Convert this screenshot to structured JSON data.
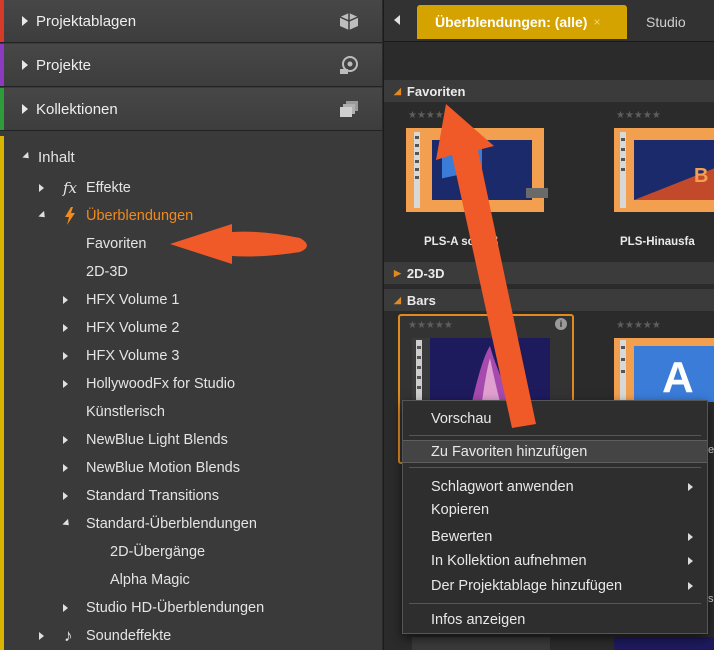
{
  "left_panel": {
    "sections": [
      {
        "label": "Projektablagen",
        "stripe": "#d83a2a",
        "icon": "project-bin-icon"
      },
      {
        "label": "Projekte",
        "stripe": "#8e3ac0",
        "icon": "projects-icon"
      },
      {
        "label": "Kollektionen",
        "stripe": "#2f9c3a",
        "icon": "collections-icon"
      }
    ],
    "inhalt": {
      "label": "Inhalt",
      "stripe": "#d8b400",
      "items": [
        {
          "label": "Effekte",
          "fx": "fx"
        },
        {
          "label": "Überblendungen",
          "accent": "#f08a1c"
        },
        {
          "label": "Favoriten"
        },
        {
          "label": "2D-3D"
        },
        {
          "label": "HFX Volume 1"
        },
        {
          "label": "HFX Volume 2"
        },
        {
          "label": "HFX Volume 3"
        },
        {
          "label": "HollywoodFx for Studio"
        },
        {
          "label": "Künstlerisch"
        },
        {
          "label": "NewBlue Light Blends"
        },
        {
          "label": "NewBlue Motion Blends"
        },
        {
          "label": "Standard Transitions"
        },
        {
          "label": "Standard-Überblendungen"
        },
        {
          "label": "2D-Übergänge"
        },
        {
          "label": "Alpha Magic"
        },
        {
          "label": "Studio HD-Überblendungen"
        },
        {
          "label": "Soundeffekte"
        }
      ]
    }
  },
  "right_panel": {
    "tabs": [
      {
        "label": "Überblendungen: (alle)",
        "close": "×",
        "active": true
      },
      {
        "label": "Studio"
      }
    ],
    "categories": [
      {
        "label": "Favoriten",
        "expanded": true
      },
      {
        "label": "2D-3D",
        "expanded": false
      },
      {
        "label": "Bars",
        "expanded": true
      }
    ],
    "favorites": [
      {
        "label": "PLS-Ausschluß",
        "visible_label": "PLS-A    schluß",
        "stars": "★★★★★"
      },
      {
        "label": "PLS-Hinausfahren",
        "visible_label": "PLS-Hinausfa",
        "stars": "★★★★★"
      }
    ],
    "bars": [
      {
        "stars": "★★★★★",
        "info": "i"
      },
      {
        "stars": "★★★★★"
      }
    ],
    "accent": "#d4a300"
  },
  "context_menu": {
    "items": [
      {
        "label": "Vorschau",
        "submenu": false
      },
      {
        "label": "Zu Favoriten hinzufügen",
        "submenu": false,
        "highlighted": true
      },
      {
        "label": "Schlagwort anwenden",
        "submenu": true
      },
      {
        "label": "Kopieren",
        "submenu": false
      },
      {
        "label": "Bewerten",
        "submenu": true
      },
      {
        "label": "In Kollektion aufnehmen",
        "submenu": true
      },
      {
        "label": "Der Projektablage hinzufügen",
        "submenu": true
      },
      {
        "label": "Infos anzeigen",
        "submenu": false
      }
    ],
    "peek_text": {
      "e": "e",
      "s": "s"
    }
  },
  "annotation_color": "#f05a28"
}
